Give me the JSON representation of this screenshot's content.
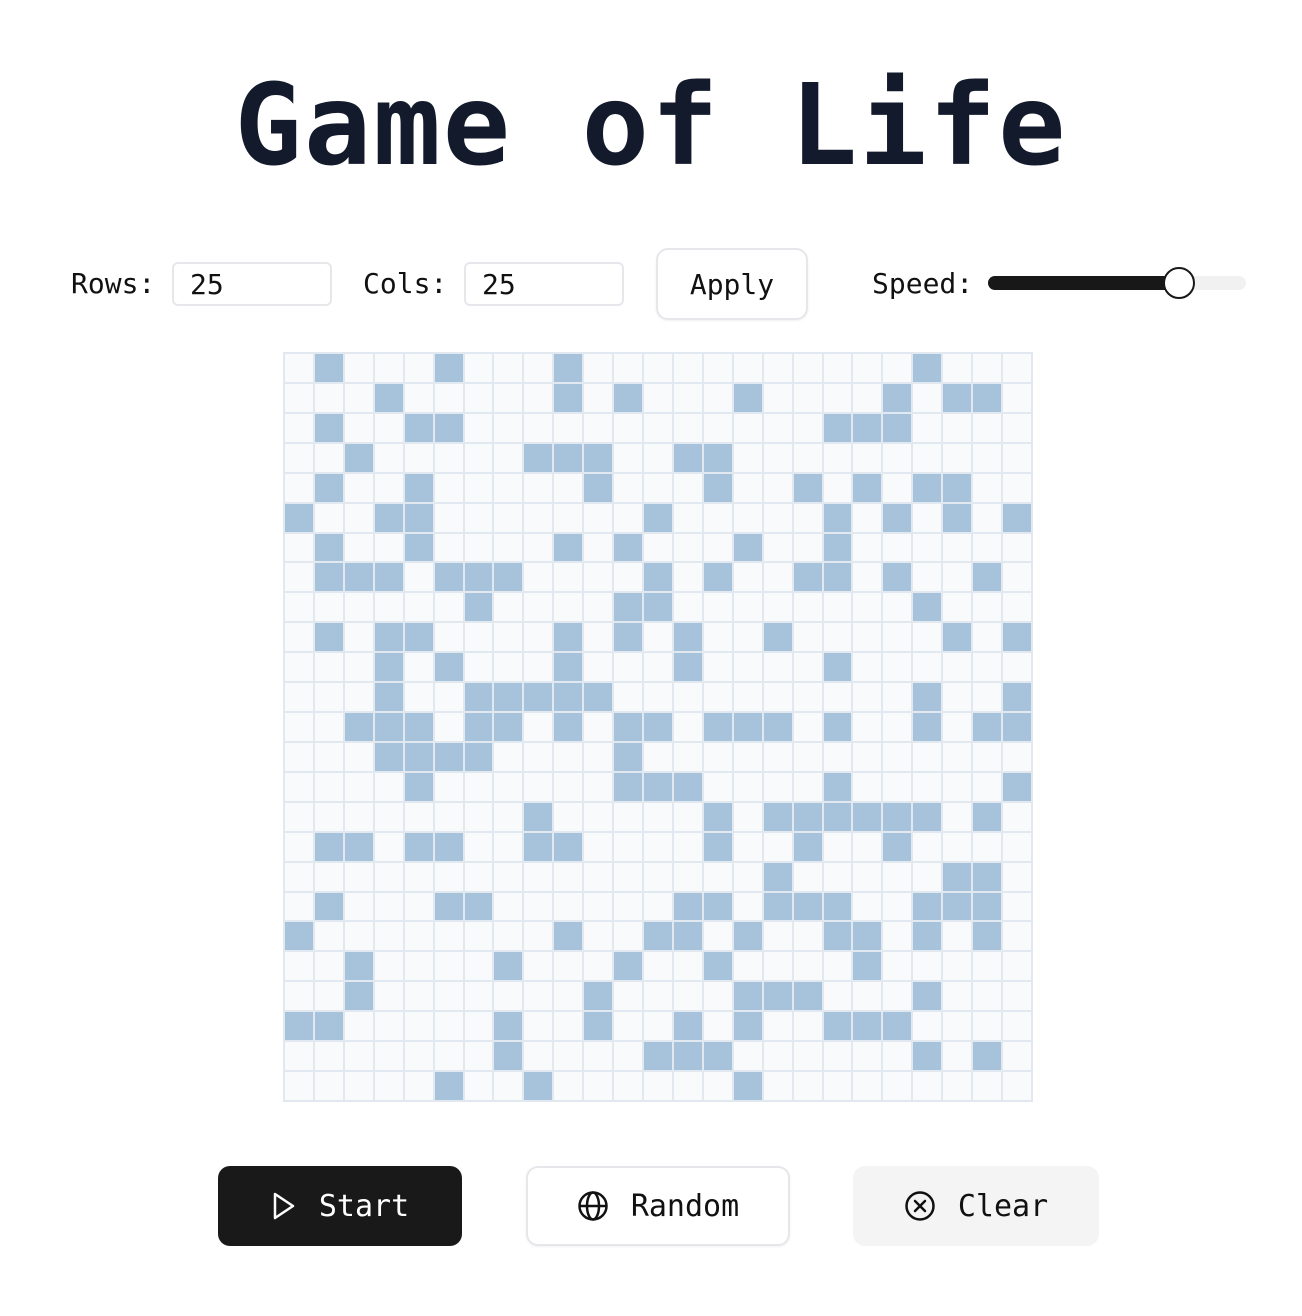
{
  "title": "Game of Life",
  "controls": {
    "rows_label": "Rows:",
    "rows_value": "25",
    "cols_label": "Cols:",
    "cols_value": "25",
    "apply_label": "Apply",
    "speed_label": "Speed:",
    "speed_fraction": 0.74
  },
  "grid": {
    "rows": 25,
    "cols": 25,
    "alive_color": "#a7c3db",
    "dead_color": "#f8fafc",
    "alive_cells": [
      [
        0,
        1
      ],
      [
        0,
        5
      ],
      [
        0,
        9
      ],
      [
        0,
        21
      ],
      [
        1,
        3
      ],
      [
        1,
        9
      ],
      [
        1,
        11
      ],
      [
        1,
        15
      ],
      [
        1,
        20
      ],
      [
        1,
        22
      ],
      [
        1,
        23
      ],
      [
        2,
        1
      ],
      [
        2,
        4
      ],
      [
        2,
        5
      ],
      [
        2,
        18
      ],
      [
        2,
        19
      ],
      [
        2,
        20
      ],
      [
        3,
        2
      ],
      [
        3,
        8
      ],
      [
        3,
        9
      ],
      [
        3,
        10
      ],
      [
        3,
        13
      ],
      [
        3,
        14
      ],
      [
        4,
        1
      ],
      [
        4,
        4
      ],
      [
        4,
        10
      ],
      [
        4,
        14
      ],
      [
        4,
        17
      ],
      [
        4,
        19
      ],
      [
        4,
        21
      ],
      [
        4,
        22
      ],
      [
        5,
        0
      ],
      [
        5,
        3
      ],
      [
        5,
        4
      ],
      [
        5,
        12
      ],
      [
        5,
        18
      ],
      [
        5,
        20
      ],
      [
        5,
        22
      ],
      [
        5,
        24
      ],
      [
        6,
        1
      ],
      [
        6,
        4
      ],
      [
        6,
        9
      ],
      [
        6,
        11
      ],
      [
        6,
        15
      ],
      [
        6,
        18
      ],
      [
        7,
        1
      ],
      [
        7,
        2
      ],
      [
        7,
        3
      ],
      [
        7,
        5
      ],
      [
        7,
        6
      ],
      [
        7,
        7
      ],
      [
        7,
        12
      ],
      [
        7,
        14
      ],
      [
        7,
        17
      ],
      [
        7,
        18
      ],
      [
        7,
        20
      ],
      [
        7,
        23
      ],
      [
        8,
        6
      ],
      [
        8,
        11
      ],
      [
        8,
        12
      ],
      [
        8,
        21
      ],
      [
        9,
        1
      ],
      [
        9,
        3
      ],
      [
        9,
        4
      ],
      [
        9,
        9
      ],
      [
        9,
        11
      ],
      [
        9,
        13
      ],
      [
        9,
        16
      ],
      [
        9,
        22
      ],
      [
        9,
        24
      ],
      [
        10,
        3
      ],
      [
        10,
        5
      ],
      [
        10,
        9
      ],
      [
        10,
        13
      ],
      [
        10,
        18
      ],
      [
        11,
        3
      ],
      [
        11,
        6
      ],
      [
        11,
        7
      ],
      [
        11,
        8
      ],
      [
        11,
        9
      ],
      [
        11,
        10
      ],
      [
        11,
        21
      ],
      [
        11,
        24
      ],
      [
        12,
        2
      ],
      [
        12,
        3
      ],
      [
        12,
        4
      ],
      [
        12,
        6
      ],
      [
        12,
        7
      ],
      [
        12,
        9
      ],
      [
        12,
        11
      ],
      [
        12,
        12
      ],
      [
        12,
        14
      ],
      [
        12,
        15
      ],
      [
        12,
        16
      ],
      [
        12,
        18
      ],
      [
        12,
        21
      ],
      [
        12,
        23
      ],
      [
        12,
        24
      ],
      [
        13,
        3
      ],
      [
        13,
        4
      ],
      [
        13,
        5
      ],
      [
        13,
        6
      ],
      [
        13,
        11
      ],
      [
        14,
        4
      ],
      [
        14,
        11
      ],
      [
        14,
        12
      ],
      [
        14,
        13
      ],
      [
        14,
        18
      ],
      [
        14,
        24
      ],
      [
        15,
        8
      ],
      [
        15,
        14
      ],
      [
        15,
        16
      ],
      [
        15,
        17
      ],
      [
        15,
        18
      ],
      [
        15,
        19
      ],
      [
        15,
        20
      ],
      [
        15,
        21
      ],
      [
        15,
        23
      ],
      [
        16,
        1
      ],
      [
        16,
        2
      ],
      [
        16,
        4
      ],
      [
        16,
        5
      ],
      [
        16,
        8
      ],
      [
        16,
        9
      ],
      [
        16,
        14
      ],
      [
        16,
        17
      ],
      [
        16,
        20
      ],
      [
        17,
        16
      ],
      [
        17,
        22
      ],
      [
        17,
        23
      ],
      [
        18,
        1
      ],
      [
        18,
        5
      ],
      [
        18,
        6
      ],
      [
        18,
        13
      ],
      [
        18,
        14
      ],
      [
        18,
        16
      ],
      [
        18,
        17
      ],
      [
        18,
        18
      ],
      [
        18,
        21
      ],
      [
        18,
        22
      ],
      [
        18,
        23
      ],
      [
        19,
        0
      ],
      [
        19,
        9
      ],
      [
        19,
        12
      ],
      [
        19,
        13
      ],
      [
        19,
        15
      ],
      [
        19,
        18
      ],
      [
        19,
        19
      ],
      [
        19,
        21
      ],
      [
        19,
        23
      ],
      [
        20,
        2
      ],
      [
        20,
        7
      ],
      [
        20,
        11
      ],
      [
        20,
        14
      ],
      [
        20,
        19
      ],
      [
        21,
        2
      ],
      [
        21,
        10
      ],
      [
        21,
        15
      ],
      [
        21,
        16
      ],
      [
        21,
        17
      ],
      [
        21,
        21
      ],
      [
        22,
        0
      ],
      [
        22,
        1
      ],
      [
        22,
        7
      ],
      [
        22,
        10
      ],
      [
        22,
        13
      ],
      [
        22,
        15
      ],
      [
        22,
        18
      ],
      [
        22,
        19
      ],
      [
        22,
        20
      ],
      [
        23,
        7
      ],
      [
        23,
        12
      ],
      [
        23,
        13
      ],
      [
        23,
        14
      ],
      [
        23,
        21
      ],
      [
        23,
        23
      ],
      [
        24,
        5
      ],
      [
        24,
        8
      ],
      [
        24,
        15
      ]
    ]
  },
  "buttons": {
    "start_label": "Start",
    "start_icon": "play-icon",
    "random_label": "Random",
    "random_icon": "globe-icon",
    "clear_label": "Clear",
    "clear_icon": "x-circle-icon"
  }
}
